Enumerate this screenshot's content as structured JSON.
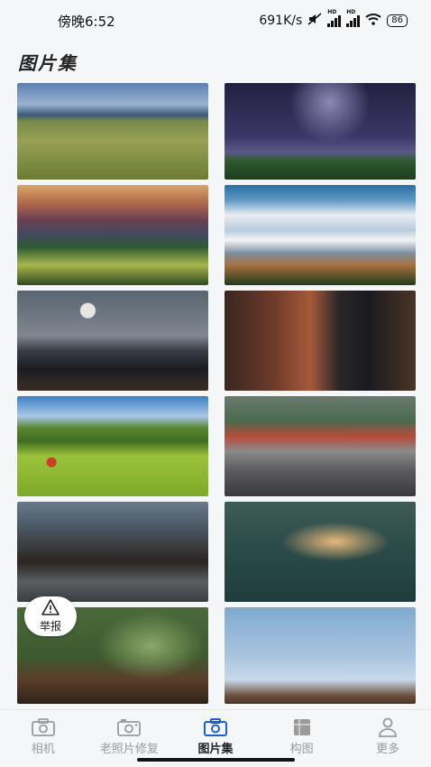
{
  "status": {
    "time": "傍晚6:52",
    "speed": "691K/s",
    "battery": "86",
    "hd": "HD"
  },
  "header": {
    "title": "图片集"
  },
  "report": {
    "label": "举报"
  },
  "tabs": [
    {
      "label": "相机",
      "icon": "camera-icon",
      "active": false
    },
    {
      "label": "老照片修复",
      "icon": "photo-camera-icon",
      "active": false
    },
    {
      "label": "图片集",
      "icon": "camera-icon",
      "active": true
    },
    {
      "label": "构图",
      "icon": "composition-icon",
      "active": false
    },
    {
      "label": "更多",
      "icon": "user-icon",
      "active": false
    }
  ],
  "colors": {
    "active_tab": "#1e5fd0",
    "inactive_tab": "#9a9a9a",
    "background": "#f5f6f8"
  }
}
